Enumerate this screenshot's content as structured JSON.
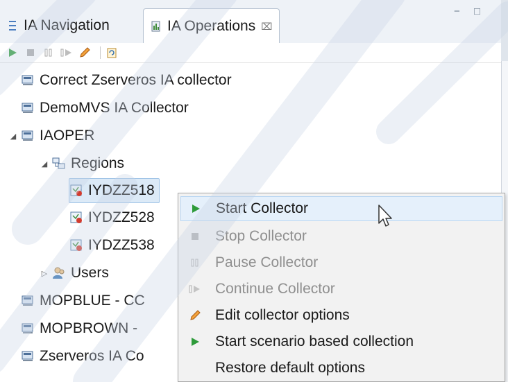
{
  "tabs": {
    "navigation_label": "IA Navigation",
    "operations_label": "IA Operations",
    "close_glyph": "⌧",
    "minimize_glyph": "−",
    "maximize_glyph": "□"
  },
  "toolbar": {
    "icons": [
      "start-icon",
      "stop-icon",
      "pause-icon",
      "continue-icon",
      "edit-icon",
      "restore-icon"
    ]
  },
  "tree": {
    "items": [
      {
        "label": "Correct Zserveros IA collector",
        "icon": "collector-icon"
      },
      {
        "label": "DemoMVS IA Collector",
        "icon": "collector-icon"
      },
      {
        "label": "IAOPER",
        "icon": "collector-icon",
        "expanded": true
      },
      {
        "label": "Regions",
        "icon": "regions-icon",
        "expanded": true
      },
      {
        "label": "IYDZZ518",
        "icon": "region-icon",
        "selected": true
      },
      {
        "label": "IYDZZ528",
        "icon": "region-icon"
      },
      {
        "label": "IYDZZ538",
        "icon": "region-icon"
      },
      {
        "label": "Users",
        "icon": "users-icon",
        "expanded": false
      },
      {
        "label": "MOPBLUE  - CC",
        "icon": "collector-icon"
      },
      {
        "label": "MOPBROWN  -",
        "icon": "collector-icon"
      },
      {
        "label": "Zserveros IA Co",
        "icon": "collector-icon"
      }
    ]
  },
  "context_menu": {
    "items": [
      {
        "label": "Start Collector",
        "icon": "play-icon",
        "enabled": true,
        "hover": true
      },
      {
        "label": "Stop Collector",
        "icon": "stop-icon",
        "enabled": false
      },
      {
        "label": "Pause Collector",
        "icon": "pause-icon",
        "enabled": false
      },
      {
        "label": "Continue Collector",
        "icon": "continue-icon",
        "enabled": false
      },
      {
        "label": "Edit collector options",
        "icon": "pencil-icon",
        "enabled": true
      },
      {
        "label": "Start scenario based collection",
        "icon": "play-icon",
        "enabled": true
      },
      {
        "label": "Restore default options",
        "icon": "none",
        "enabled": true
      }
    ]
  },
  "colors": {
    "play_green": "#2e9b3a",
    "selection_bg": "#dceaf7",
    "menu_hover": "#e5f0fb",
    "disabled_text": "#8f8f8f",
    "watermark": "#c8d4e6"
  }
}
